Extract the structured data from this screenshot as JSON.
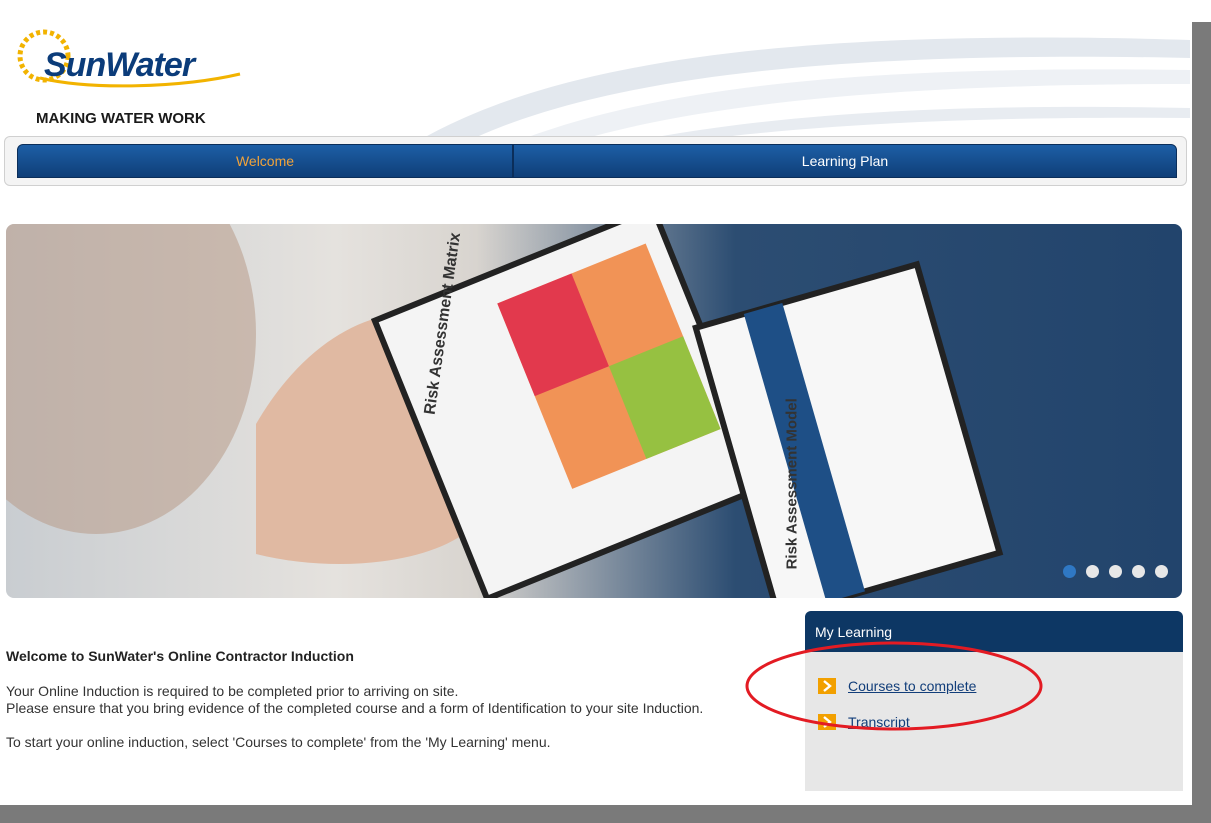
{
  "header": {
    "logo_text": "SunWater",
    "tagline": "MAKING WATER WORK"
  },
  "nav": {
    "tabs": [
      {
        "label": "Welcome"
      },
      {
        "label": "Learning Plan"
      }
    ]
  },
  "hero": {
    "image_label_1": "Risk Assessment Matrix",
    "image_label_2": "Risk Assessment Model",
    "carousel_total": 5,
    "carousel_active": 1
  },
  "welcome": {
    "heading": "Welcome to SunWater's Online Contractor Induction",
    "para1": "Your Online Induction is required to be completed prior to arriving on site.\nPlease ensure that you bring evidence of the completed course and a form of Identification to your site Induction.",
    "para2": "To start your online induction, select 'Courses to complete' from the 'My Learning' menu."
  },
  "sidebar": {
    "title": "My Learning",
    "items": [
      {
        "label": "Courses to complete"
      },
      {
        "label": "Transcript"
      }
    ]
  },
  "colors": {
    "nav_blue": "#14508f",
    "active_tab_text": "#f2a33a",
    "panel_header": "#0d3764",
    "highlight": "#e31b23"
  }
}
